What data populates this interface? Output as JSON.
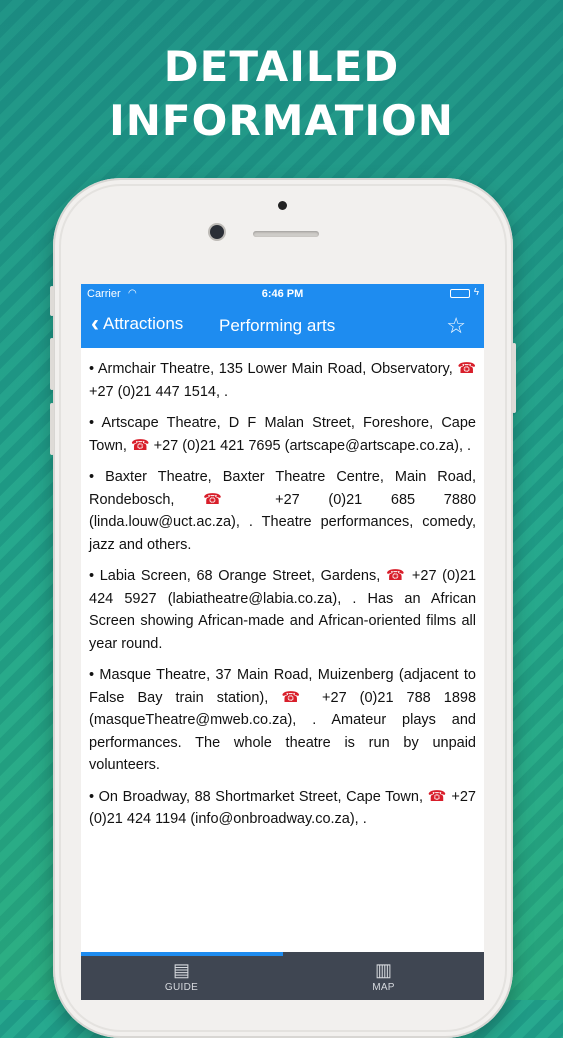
{
  "headline": {
    "line1": "DETAILED",
    "line2": "INFORMATION"
  },
  "statusbar": {
    "carrier": "Carrier",
    "time": "6:46 PM",
    "wifi_icon": "wifi-icon",
    "battery_icon": "battery-icon"
  },
  "navbar": {
    "back_label": "Attractions",
    "title": "Performing arts",
    "favorite_icon": "star-icon",
    "accent_color": "#1e8cf0"
  },
  "entries": [
    {
      "before": "• Armchair Theatre, 135 Lower Main Road, Observatory,",
      "phone": "+27 (0)21 447 1514",
      "after": ", ."
    },
    {
      "before": "• Artscape Theatre, D F Malan Street, Foreshore, Cape Town,",
      "phone": "+27 (0)21 421 7695",
      "after": "(artscape@artscape.co.za), ."
    },
    {
      "before": "• Baxter Theatre, Baxter Theatre Centre, Main Road, Rondebosch,",
      "phone": "+27 (0)21 685 7880",
      "after": "(linda.louw@uct.ac.za), . Theatre performances, comedy, jazz and others."
    },
    {
      "before": "• Labia Screen, 68 Orange Street, Gardens,",
      "phone": "+27 (0)21 424 5927",
      "after": "(labiatheatre@labia.co.za), . Has an African Screen showing African-made and African-oriented films all year round."
    },
    {
      "before": "• Masque Theatre, 37 Main Road, Muizenberg (adjacent to False Bay train station),",
      "phone": "+27 (0)21 788 1898",
      "after": "(masqueTheatre@mweb.co.za), . Amateur plays and performances. The whole theatre is run by unpaid volunteers."
    },
    {
      "before": "• On Broadway, 88 Shortmarket Street, Cape Town,",
      "phone": "+27 (0)21 424 1194",
      "after": "(info@onbroadway.co.za), ."
    }
  ],
  "tabbar": {
    "tabs": [
      {
        "label": "GUIDE",
        "icon": "book-icon"
      },
      {
        "label": "MAP",
        "icon": "map-icon"
      }
    ],
    "selected": "GUIDE"
  }
}
